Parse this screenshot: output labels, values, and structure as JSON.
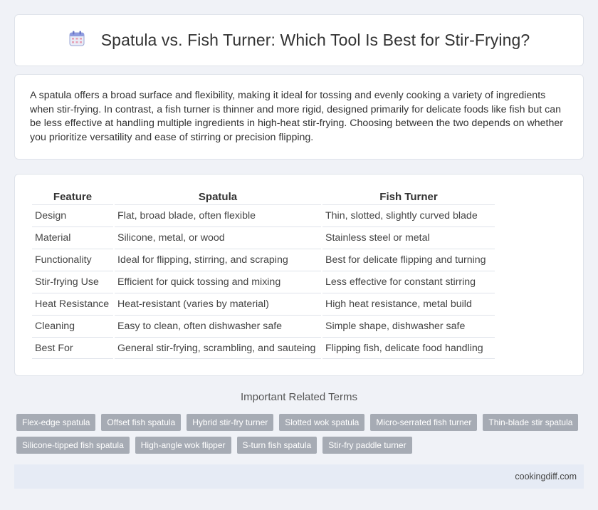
{
  "header": {
    "icon": "calendar-icon",
    "title": "Spatula vs. Fish Turner: Which Tool Is Best for Stir-Frying?"
  },
  "intro": {
    "text": "A spatula offers a broad surface and flexibility, making it ideal for tossing and evenly cooking a variety of ingredients when stir-frying. In contrast, a fish turner is thinner and more rigid, designed primarily for delicate foods like fish but can be less effective at handling multiple ingredients in high-heat stir-frying. Choosing between the two depends on whether you prioritize versatility and ease of stirring or precision flipping."
  },
  "table": {
    "headers": [
      "Feature",
      "Spatula",
      "Fish Turner"
    ],
    "rows": [
      [
        "Design",
        "Flat, broad blade, often flexible",
        "Thin, slotted, slightly curved blade"
      ],
      [
        "Material",
        "Silicone, metal, or wood",
        "Stainless steel or metal"
      ],
      [
        "Functionality",
        "Ideal for flipping, stirring, and scraping",
        "Best for delicate flipping and turning"
      ],
      [
        "Stir-frying Use",
        "Efficient for quick tossing and mixing",
        "Less effective for constant stirring"
      ],
      [
        "Heat Resistance",
        "Heat-resistant (varies by material)",
        "High heat resistance, metal build"
      ],
      [
        "Cleaning",
        "Easy to clean, often dishwasher safe",
        "Simple shape, dishwasher safe"
      ],
      [
        "Best For",
        "General stir-frying, scrambling, and sauteing",
        "Flipping fish, delicate food handling"
      ]
    ]
  },
  "related": {
    "title": "Important Related Terms",
    "tags": [
      "Flex-edge spatula",
      "Offset fish spatula",
      "Hybrid stir-fry turner",
      "Slotted wok spatula",
      "Micro-serrated fish turner",
      "Thin-blade stir spatula",
      "Silicone-tipped fish spatula",
      "High-angle wok flipper",
      "S-turn fish spatula",
      "Stir-fry paddle turner"
    ]
  },
  "footer": {
    "site": "cookingdiff.com"
  }
}
